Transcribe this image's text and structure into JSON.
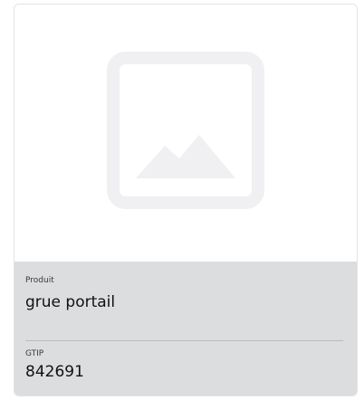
{
  "card": {
    "image": {
      "icon": "image-placeholder-icon"
    },
    "fields": {
      "product_label": "Produit",
      "product_value": "grue portail",
      "gtip_label": "GTIP",
      "gtip_value": "842691"
    }
  },
  "colors": {
    "card_border": "#e2e3e5",
    "panel_background": "#dcdddf",
    "icon_color": "#f0f0f3",
    "text_primary": "#111111",
    "text_secondary": "#3a3a3a"
  }
}
